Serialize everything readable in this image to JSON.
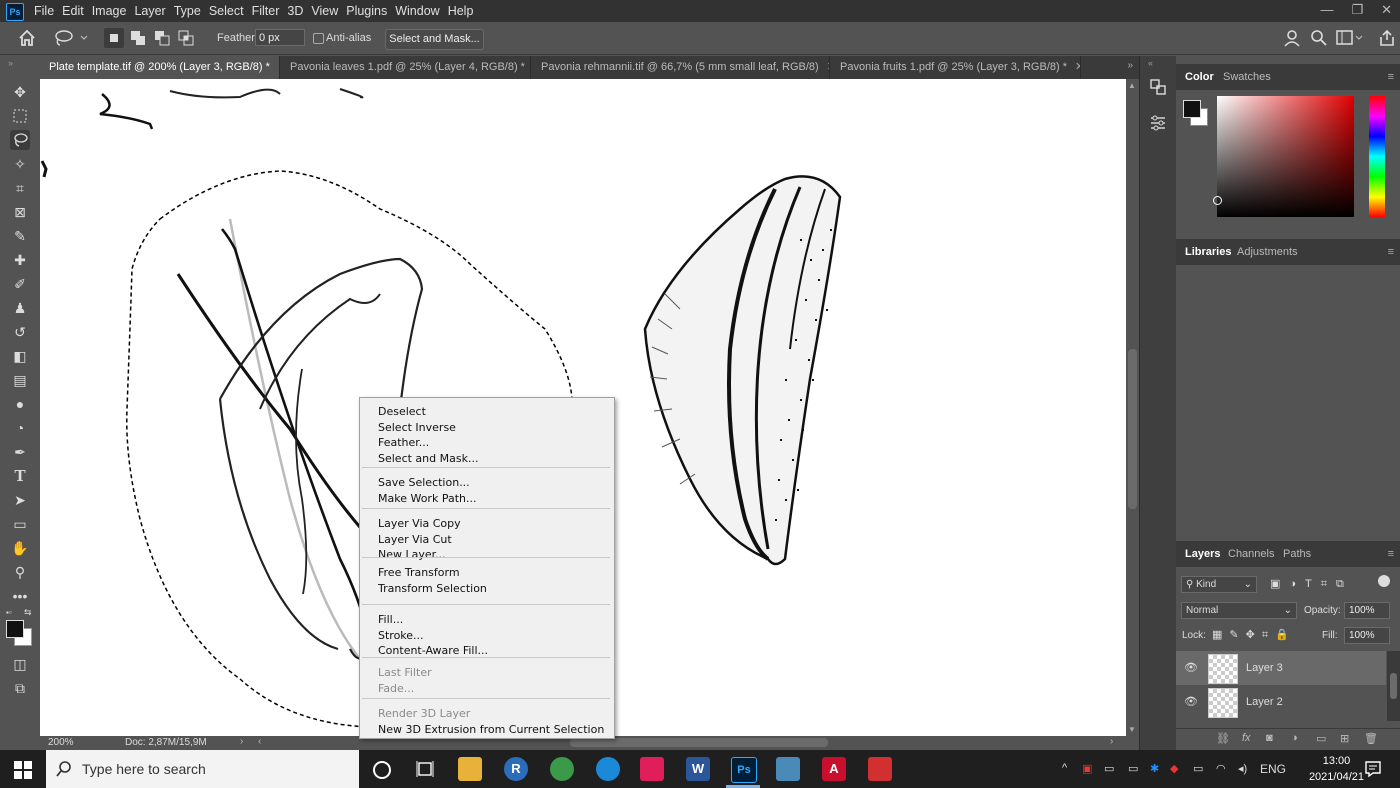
{
  "app": {
    "logo": "Ps"
  },
  "menubar": {
    "items": [
      "File",
      "Edit",
      "Image",
      "Layer",
      "Type",
      "Select",
      "Filter",
      "3D",
      "View",
      "Plugins",
      "Window",
      "Help"
    ]
  },
  "options": {
    "feather_label": "Feather:",
    "feather_value": "0 px",
    "antialias_label": "Anti-alias",
    "select_mask_label": "Select and Mask..."
  },
  "tabs": [
    {
      "label": "Plate template.tif @ 200% (Layer 3, RGB/8) *"
    },
    {
      "label": "Pavonia leaves 1.pdf @ 25% (Layer 4, RGB/8) *"
    },
    {
      "label": "Pavonia rehmannii.tif @ 66,7% (5 mm small leaf, RGB/8)"
    },
    {
      "label": "Pavonia fruits 1.pdf @ 25% (Layer 3, RGB/8) *"
    }
  ],
  "status": {
    "zoom": "200%",
    "doc": "Doc: 2,87M/15,9M"
  },
  "panels": {
    "color_tab": "Color",
    "swatches_tab": "Swatches",
    "libraries_tab": "Libraries",
    "adjustments_tab": "Adjustments",
    "layers_tab": "Layers",
    "channels_tab": "Channels",
    "paths_tab": "Paths",
    "kind_label": "Kind",
    "blend_mode": "Normal",
    "opacity_label": "Opacity:",
    "opacity_value": "100%",
    "lock_label": "Lock:",
    "fill_label": "Fill:",
    "fill_value": "100%",
    "layers": [
      {
        "name": "Layer 3",
        "selected": true
      },
      {
        "name": "Layer 2",
        "selected": false
      }
    ]
  },
  "context_menu": {
    "groups": [
      [
        {
          "label": "Deselect"
        },
        {
          "label": "Select Inverse"
        },
        {
          "label": "Feather..."
        },
        {
          "label": "Select and Mask..."
        }
      ],
      [
        {
          "label": "Save Selection..."
        },
        {
          "label": "Make Work Path..."
        }
      ],
      [
        {
          "label": "Layer Via Copy"
        },
        {
          "label": "Layer Via Cut"
        },
        {
          "label": "New Layer..."
        }
      ],
      [
        {
          "label": "Free Transform"
        },
        {
          "label": "Transform Selection"
        }
      ],
      [
        {
          "label": "Fill..."
        },
        {
          "label": "Stroke..."
        },
        {
          "label": "Content-Aware Fill..."
        }
      ],
      [
        {
          "label": "Last Filter",
          "disabled": true
        },
        {
          "label": "Fade...",
          "disabled": true
        }
      ],
      [
        {
          "label": "Render 3D Layer",
          "disabled": true
        },
        {
          "label": "New 3D Extrusion from Current Selection"
        }
      ]
    ]
  },
  "taskbar": {
    "search_placeholder": "Type here to search",
    "lang": "ENG",
    "time": "13:00",
    "date": "2021/04/21",
    "apps": [
      {
        "icon": "file-explorer-icon",
        "color": "#e8b23a",
        "glyph": ""
      },
      {
        "icon": "r-icon",
        "color": "#2a6ebb",
        "glyph": "R"
      },
      {
        "icon": "chrome-icon",
        "color": "#3b9a4a",
        "glyph": ""
      },
      {
        "icon": "edge-icon",
        "color": "#1a8ad8",
        "glyph": ""
      },
      {
        "icon": "slack-icon",
        "color": "#e01e5a",
        "glyph": ""
      },
      {
        "icon": "word-icon",
        "color": "#2b579a",
        "glyph": "W"
      },
      {
        "icon": "photoshop-icon",
        "color": "#001e36",
        "glyph": "Ps"
      },
      {
        "icon": "photos-icon",
        "color": "#4a8ab8",
        "glyph": ""
      },
      {
        "icon": "acrobat-icon",
        "color": "#c8102e",
        "glyph": "A"
      },
      {
        "icon": "app-icon",
        "color": "#d23030",
        "glyph": ""
      }
    ]
  }
}
